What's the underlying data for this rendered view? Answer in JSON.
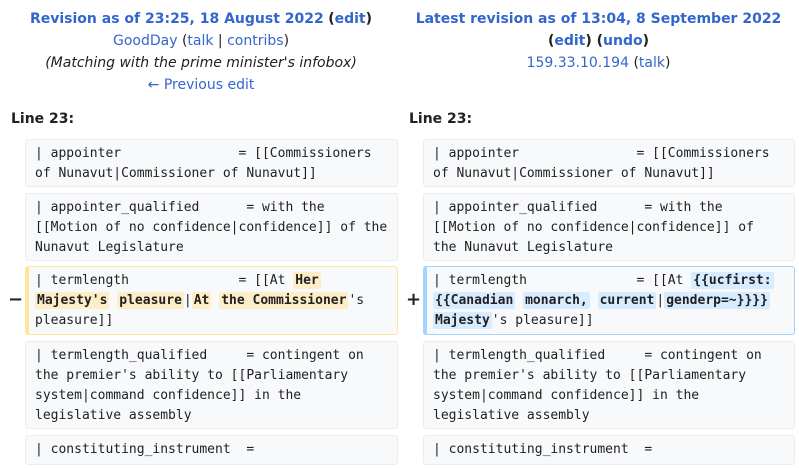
{
  "left_header": {
    "title": "Revision as of 23:25, 18 August 2022",
    "edit": "edit",
    "user": "GoodDay",
    "talk": "talk",
    "contribs": "contribs",
    "summary": "(Matching with the prime minister's infobox)",
    "prev": "← Previous edit"
  },
  "right_header": {
    "title": "Latest revision as of 13:04, 8 September 2022",
    "edit": "edit",
    "undo": "undo",
    "user": "159.33.10.194",
    "talk": "talk"
  },
  "line_label": "Line 23:",
  "rows": [
    {
      "left": "| appointer               = [[Commissioners of Nunavut|Commissioner of Nunavut]]",
      "right": "| appointer               = [[Commissioners of Nunavut|Commissioner of Nunavut]]"
    },
    {
      "left": "| appointer_qualified      = with the [[Motion of no confidence|confidence]] of the Nunavut Legislature",
      "right": "| appointer_qualified      = with the [[Motion of no confidence|confidence]] of the Nunavut Legislature"
    },
    {
      "del_prefix": "| termlength              = [[At ",
      "del_parts": [
        "Her",
        "Majesty's",
        "pleasure",
        "At",
        "the Commissioner"
      ],
      "del_suffix": "'s pleasure]]",
      "add_prefix": "| termlength              = [[At ",
      "add_parts": [
        "{{ucfirst:",
        "{{Canadian",
        "monarch,",
        "current",
        "genderp=~}}}}",
        "Majesty"
      ],
      "add_suffix": "'s pleasure]]",
      "minus": "−",
      "plus": "+"
    },
    {
      "left": "| termlength_qualified     = contingent on the premier's ability to [[Parliamentary system|command confidence]] in the legislative assembly",
      "right": "| termlength_qualified     = contingent on the premier's ability to [[Parliamentary system|command confidence]] in the legislative assembly"
    },
    {
      "left": "| constituting_instrument  =",
      "right": "| constituting_instrument  ="
    }
  ]
}
